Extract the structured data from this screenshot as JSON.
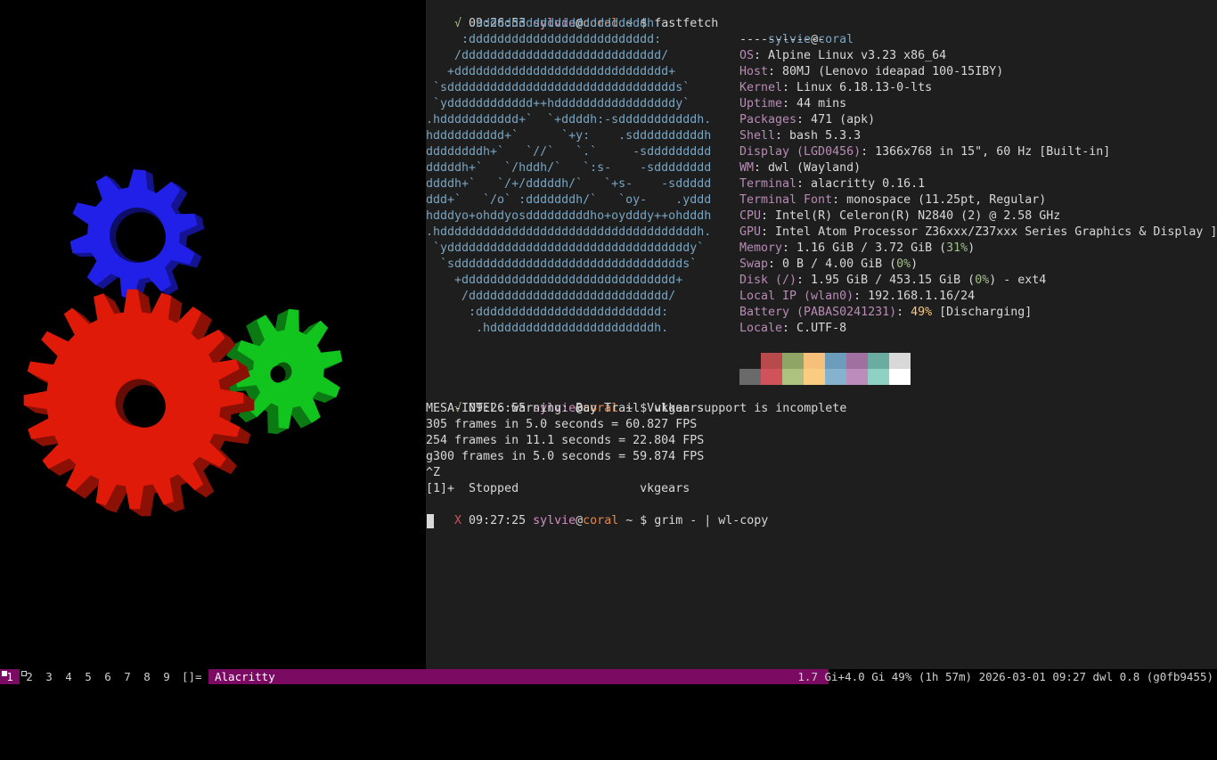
{
  "terminal": {
    "prompt1": {
      "mark": "√",
      "time": " 09:26:53 ",
      "user": "sylvie",
      "at": "@",
      "host": "coral",
      "rest": " ~ $ fastfetch"
    },
    "logo": [
      "      .hdddddddddddddddddddddddh.",
      "     :dddddddddddddddddddddddddd:",
      "    /dddddddddddddddddddddddddddd/",
      "   +dddddddddddddddddddddddddddddd+",
      " `sdddddddddddddddddddddddddddddddds`",
      " `ydddddddddddd++hdddddddddddddddddy`",
      ".hddddddddddd+`  `+ddddh:-sdddddddddddh.",
      "hdddddddddd+`      `+y:    .sddddddddddh",
      "ddddddddh+`   `//`   `.`     -sddddddddd",
      "dddddh+`   `/hddh/`   `:s-    -sdddddddd",
      "ddddh+`   `/+/dddddh/`   `+s-    -sddddd",
      "ddd+`   `/o` :dddddddh/`   `oy-    .yddd",
      "hdddyo+ohddyosdddddddddho+oydddy++ohdddh",
      ".hddddddddddddddddddddddddddddddddddddh.",
      " `yddddddddddddddddddddddddddddddddddy`",
      "  `sdddddddddddddddddddddddddddddddds`",
      "    +dddddddddddddddddddddddddddddd+",
      "     /dddddddddddddddddddddddddddd/",
      "      :dddddddddddddddddddddddddd:",
      "       .hdddddddddddddddddddddddh."
    ],
    "info": {
      "title_user": "sylvie",
      "title_at": "@",
      "title_host": "coral",
      "separator": "------------",
      "rows": [
        {
          "k": "OS",
          "v": ": Alpine Linux v3.23 x86_64"
        },
        {
          "k": "Host",
          "v": ": 80MJ (Lenovo ideapad 100-15IBY)"
        },
        {
          "k": "Kernel",
          "v": ": Linux 6.18.13-0-lts"
        },
        {
          "k": "Uptime",
          "v": ": 44 mins"
        },
        {
          "k": "Packages",
          "v": ": 471 (apk)"
        },
        {
          "k": "Shell",
          "v": ": bash 5.3.3"
        },
        {
          "k": "Display (LGD0456)",
          "v": ": 1366x768 in 15\", 60 Hz [Built-in]"
        },
        {
          "k": "WM",
          "v": ": dwl (Wayland)"
        },
        {
          "k": "Terminal",
          "v": ": alacritty 0.16.1"
        },
        {
          "k": "Terminal Font",
          "v": ": monospace (11.25pt, Regular)"
        },
        {
          "k": "CPU",
          "v": ": Intel(R) Celeron(R) N2840 (2) @ 2.58 GHz"
        },
        {
          "k": "GPU",
          "v": ": Intel Atom Processor Z36xxx/Z37xxx Series Graphics & Display ]"
        },
        {
          "k": "Memory",
          "v": ": 1.16 GiB / 3.72 GiB (",
          "p": "31%",
          "t": ")",
          "pc": "pct-ok"
        },
        {
          "k": "Swap",
          "v": ": 0 B / 4.00 GiB (",
          "p": "0%",
          "t": ")",
          "pc": "pct-ok"
        },
        {
          "k": "Disk (/)",
          "v": ": 1.95 GiB / 453.15 GiB (",
          "p": "0%",
          "t": ") - ext4",
          "pc": "pct-ok"
        },
        {
          "k": "Local IP (wlan0)",
          "v": ": 192.168.1.16/24"
        },
        {
          "k": "Battery (PABAS0241231)",
          "v": ": ",
          "p": "49%",
          "t": " [Discharging]",
          "pc": "pct-warn"
        },
        {
          "k": "Locale",
          "v": ": C.UTF-8"
        }
      ]
    },
    "palette_top": [
      "#1e1e1e",
      "#b94a4c",
      "#8fa566",
      "#f7c07a",
      "#6b9cbc",
      "#a070a0",
      "#6aaca0",
      "#d8d8d8"
    ],
    "palette_bottom": [
      "#6a6a6a",
      "#d0525b",
      "#acc27e",
      "#fccb82",
      "#85b2cd",
      "#bb8cbc",
      "#8fd1c3",
      "#ffffff"
    ],
    "prompt2": {
      "mark": "√",
      "time": " 09:26:55 ",
      "user": "sylvie",
      "at": "@",
      "host": "coral",
      "rest": " ~ $ vkgears"
    },
    "output": [
      "MESA-INTEL: warning: Bay Trail Vulkan support is incomplete",
      "305 frames in 5.0 seconds = 60.827 FPS",
      "254 frames in 11.1 seconds = 22.804 FPS",
      "g300 frames in 5.0 seconds = 59.874 FPS",
      "^Z",
      "[1]+  Stopped                 vkgears"
    ],
    "prompt3": {
      "mark": "X",
      "time": " 09:27:25 ",
      "user": "sylvie",
      "at": "@",
      "host": "coral",
      "rest": " ~ $ grim - | wl-copy"
    }
  },
  "bar": {
    "tags": [
      "1",
      "2",
      "3",
      "4",
      "5",
      "6",
      "7",
      "8",
      "9"
    ],
    "layout": "[]=",
    "window_title": "Alacritty",
    "status": "1.7 Gi+4.0 Gi 49% (1h 57m) 2026-03-01 09:27 dwl 0.8 (g0fb9455)"
  },
  "colors": {
    "terminal_bg": "#1e1e1e",
    "bar_accent": "#7a0a62",
    "gear_red": "#e01a08",
    "gear_green": "#12c51e",
    "gear_blue": "#2020e8"
  }
}
